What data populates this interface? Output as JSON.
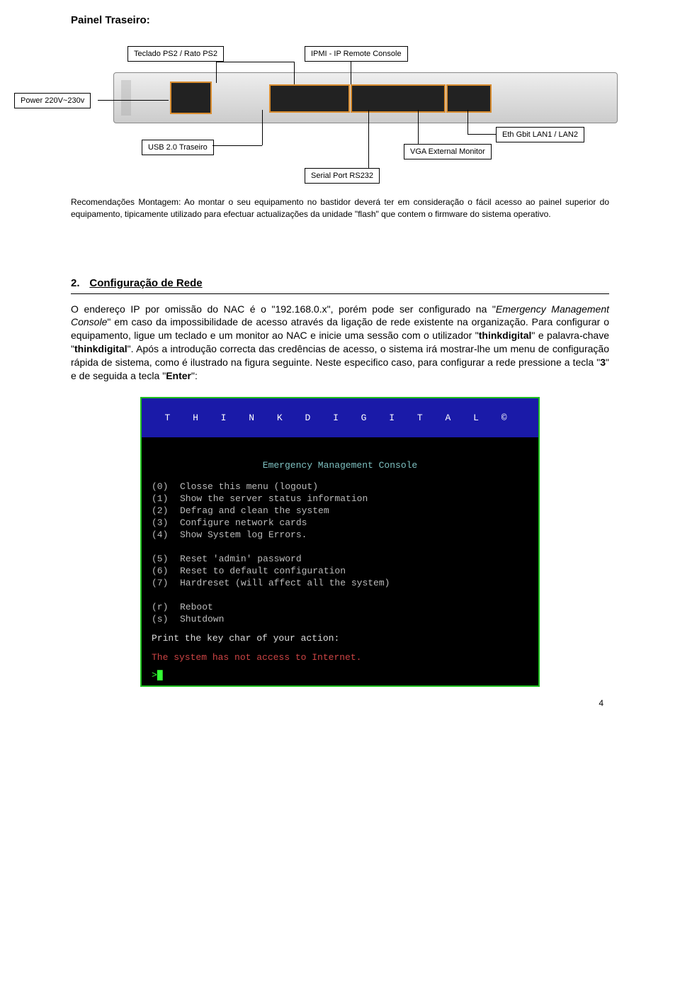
{
  "title": "Painel Traseiro:",
  "labels": {
    "teclado": "Teclado PS2 / Rato PS2",
    "ipmi": "IPMI - IP Remote Console",
    "power": "Power 220V~230v",
    "usb": "USB 2.0 Traseiro",
    "eth": "Eth Gbit LAN1 / LAN2",
    "vga": "VGA External Monitor",
    "serial": "Serial Port RS232"
  },
  "rec_text": "Recomendações Montagem: Ao montar o seu equipamento no bastidor deverá ter em consideração o fácil acesso ao painel superior do equipamento, tipicamente utilizado para efectuar actualizações da unidade \"flash\" que contem o firmware do sistema operativo.",
  "section": {
    "num": "2.",
    "title": "Configuração de Rede"
  },
  "body": {
    "p1a": "O endereço IP por omissão do NAC é o \"192.168.0.x\", porém pode ser configurado na \"",
    "p1b_i": "Emergency Management Console",
    "p1c": "\" em caso da impossibilidade de acesso através da ligação de rede existente na organização. Para configurar o equipamento, ligue um teclado e um monitor ao NAC e inicie uma sessão com o utilizador \"",
    "p1d_b": "thinkdigital",
    "p1e": "\" e palavra-chave \"",
    "p1f_b": "thinkdigital",
    "p1g": "\". Após a introdução correcta das credências de acesso, o sistema irá mostrar-lhe um menu de configuração rápida de sistema, como é ilustrado na figura seguinte. Neste especifico caso, para configurar a rede pressione a tecla \"",
    "p1h_b": "3",
    "p1i": "\" e de seguida a tecla \"",
    "p1j_b": "Enter",
    "p1k": "\":"
  },
  "console": {
    "banner": "T H I N K D I G I T A L ©",
    "emc": "Emergency Management Console",
    "menu": [
      {
        "n": "(0)",
        "t": "Closse this menu  (logout)"
      },
      {
        "n": "(1)",
        "t": "Show the server status information"
      },
      {
        "n": "(2)",
        "t": "Defrag and clean the system"
      },
      {
        "n": "(3)",
        "t": "Configure network cards"
      },
      {
        "n": "(4)",
        "t": "Show System log Errors."
      },
      {
        "n": "",
        "t": ""
      },
      {
        "n": "(5)",
        "t": "Reset 'admin' password"
      },
      {
        "n": "(6)",
        "t": "Reset to default configuration"
      },
      {
        "n": "(7)",
        "t": "Hardreset (will affect all the system)"
      },
      {
        "n": "",
        "t": ""
      },
      {
        "n": "(r)",
        "t": "Reboot"
      },
      {
        "n": "(s)",
        "t": "Shutdown"
      }
    ],
    "prompt_label": "Print the key char of your action:",
    "warn": "The system has not access to Internet.",
    "cursor": ">"
  },
  "page_number": "4"
}
